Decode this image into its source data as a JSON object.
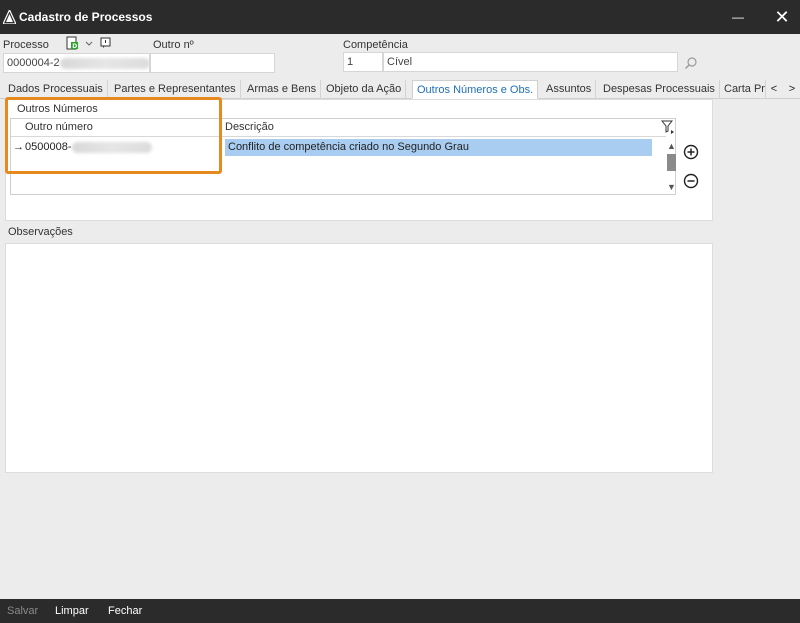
{
  "window": {
    "title": "Cadastro de Processos",
    "minimize_glyph": "—",
    "close_glyph": "✕"
  },
  "header": {
    "processo_label": "Processo",
    "processo_value": "0000004-2",
    "outro_label": "Outro nº",
    "competencia_label": "Competência",
    "competencia_code": "1",
    "competencia_name": "Cível"
  },
  "tabs": [
    {
      "label": "Dados Processuais"
    },
    {
      "label": "Partes e Representantes"
    },
    {
      "label": "Armas e Bens"
    },
    {
      "label": "Objeto da Ação"
    },
    {
      "label": "Outros Números e Obs.",
      "active": true
    },
    {
      "label": "Assuntos"
    },
    {
      "label": "Despesas Processuais"
    },
    {
      "label": "Carta Pr"
    }
  ],
  "tab_nav": {
    "left": "<",
    "right": ">"
  },
  "outros_numeros": {
    "group_title": "Outros Números",
    "columns": [
      "Outro número",
      "Descrição"
    ],
    "rows": [
      {
        "marker": "→",
        "numero": "0500008-",
        "descricao": "Conflito de competência criado no Segundo Grau"
      }
    ]
  },
  "observacoes": {
    "label": "Observações",
    "value": ""
  },
  "footer": {
    "salvar": "Salvar",
    "limpar": "Limpar",
    "fechar": "Fechar"
  },
  "colors": {
    "accent_tab": "#1f6fb8",
    "selected_row": "#a9cdf0",
    "highlight": "#e68a1f",
    "chrome": "#2b2b2b"
  }
}
